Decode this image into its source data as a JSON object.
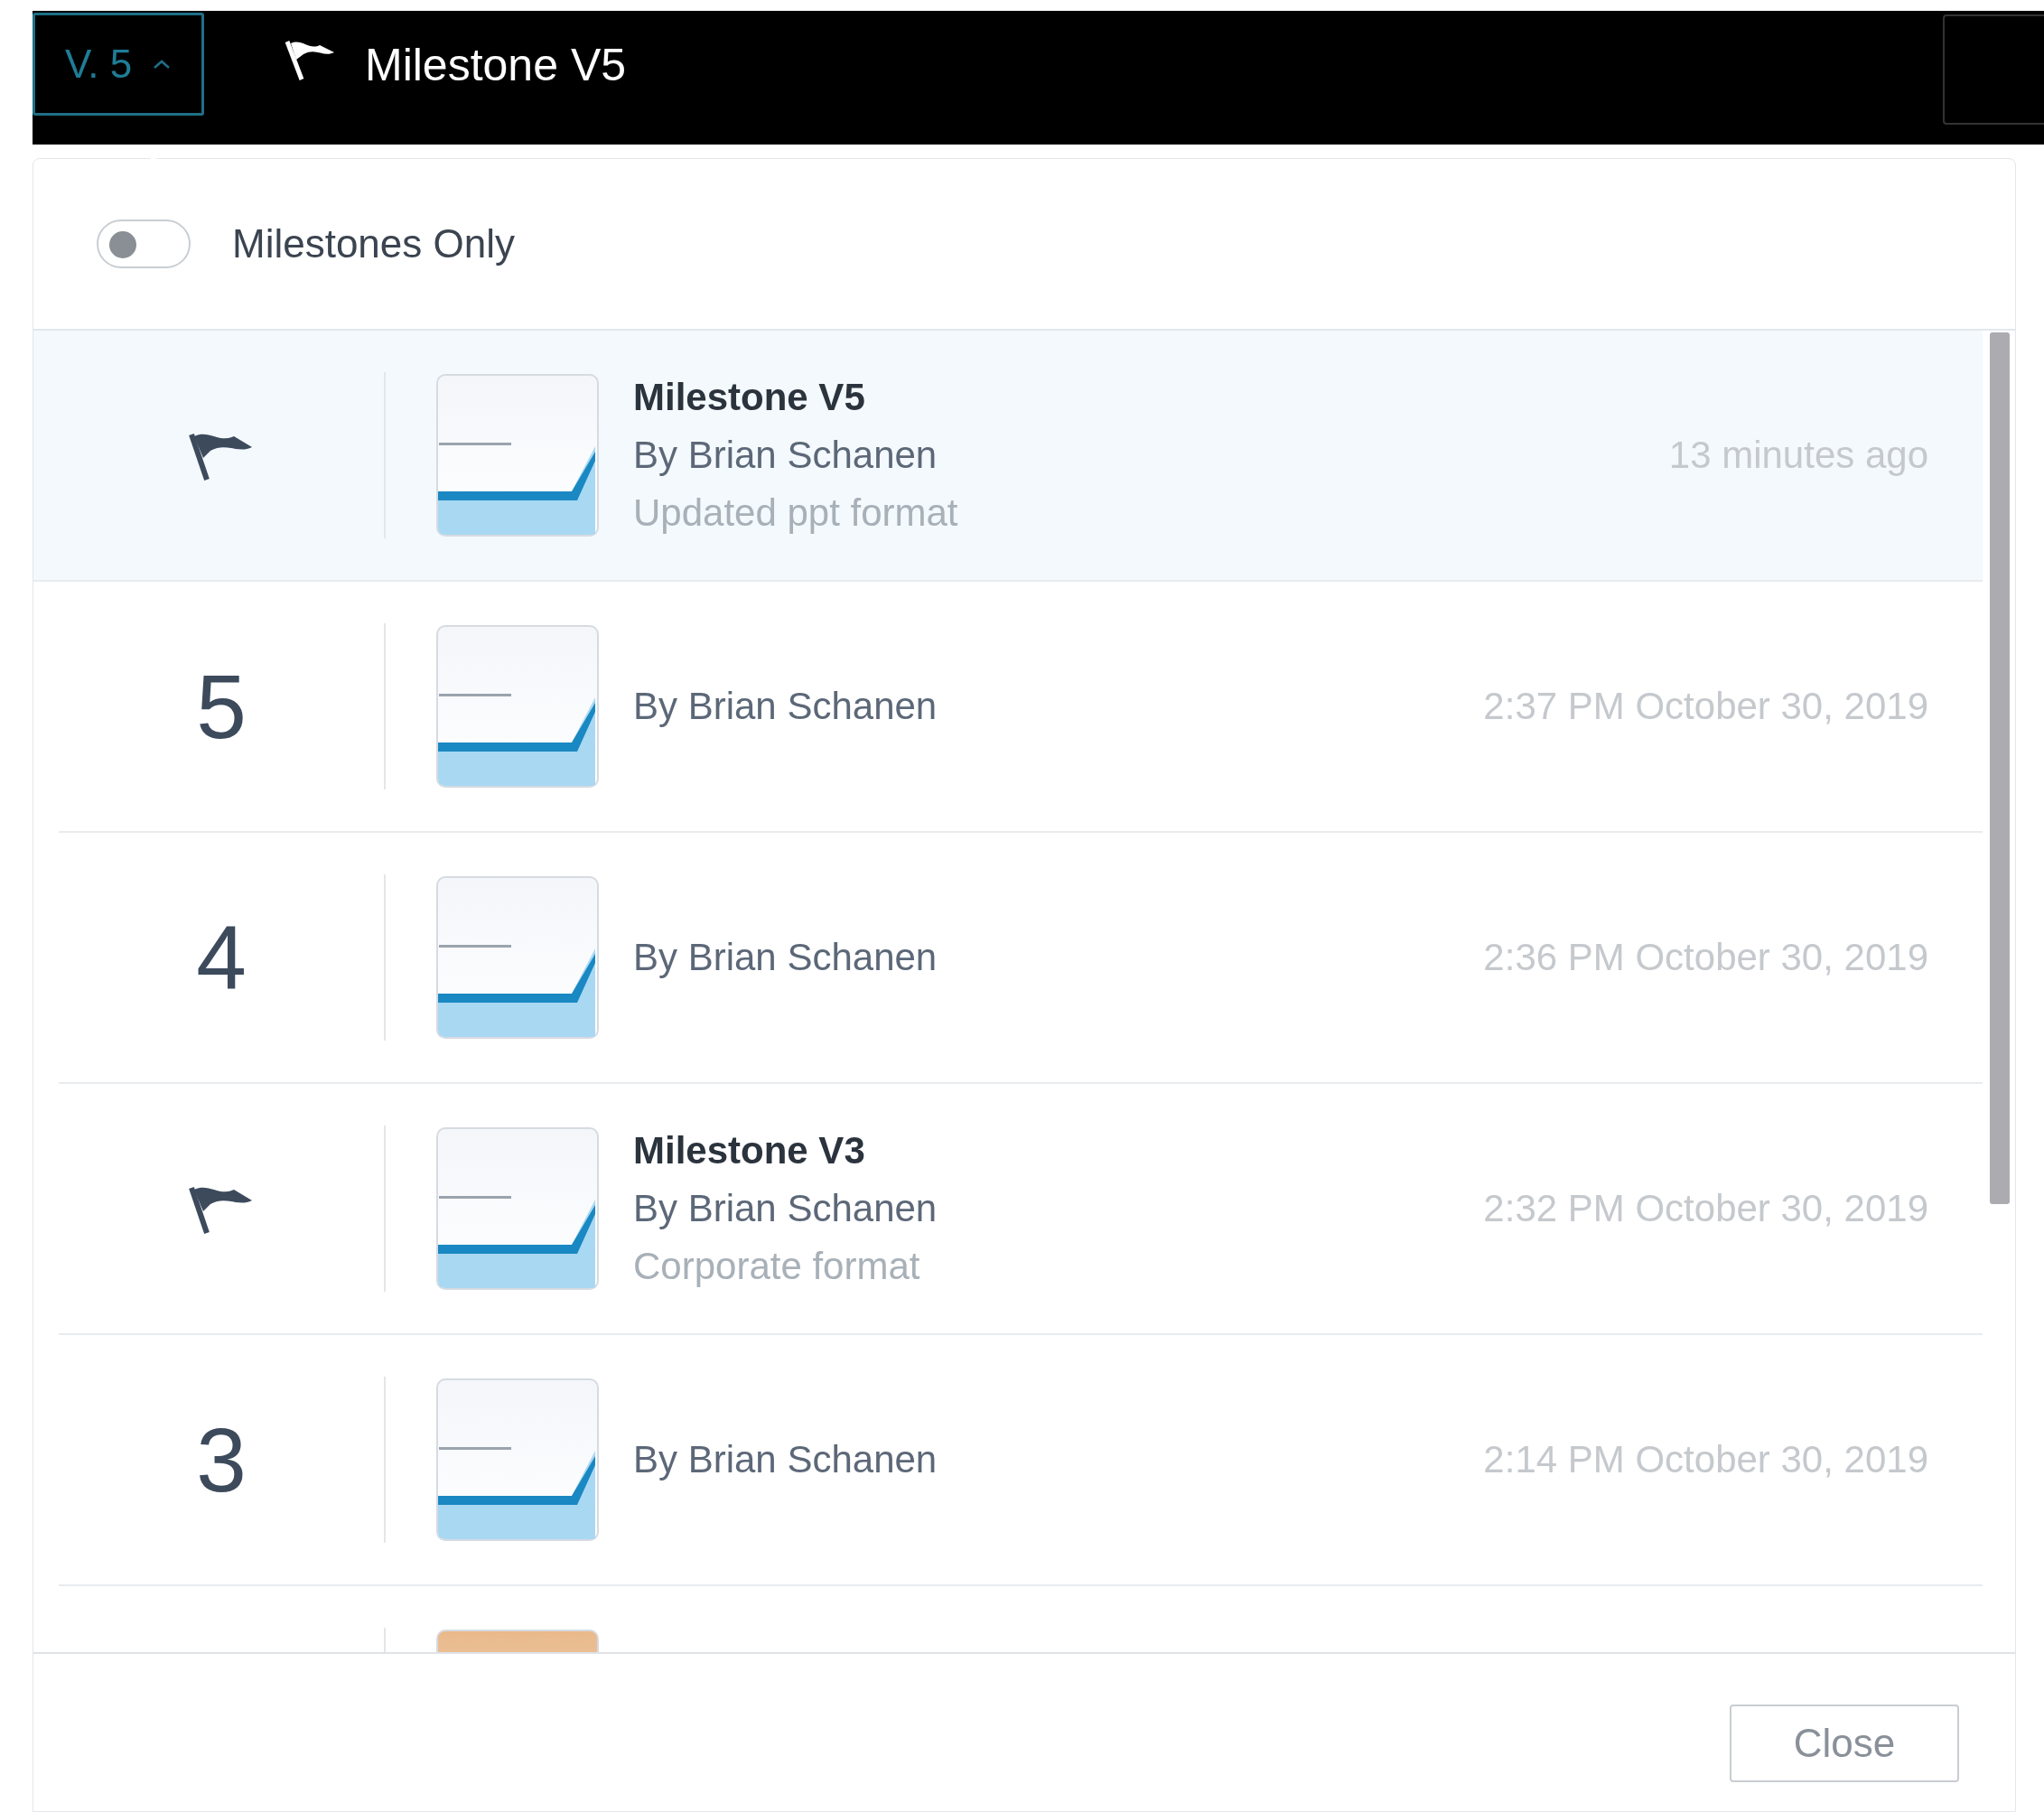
{
  "version_button": {
    "label": "V. 5",
    "expanded": true
  },
  "header": {
    "title": "Milestone V5"
  },
  "milestones_toggle": {
    "label": "Milestones Only",
    "on": false
  },
  "versions": [
    {
      "kind": "milestone",
      "selected": true,
      "title": "Milestone V5",
      "author": "By Brian Schanen",
      "note": "Updated ppt format",
      "time": "13 minutes ago"
    },
    {
      "kind": "version",
      "number": "5",
      "selected": false,
      "author": "By Brian Schanen",
      "time": "2:37 PM October 30, 2019"
    },
    {
      "kind": "version",
      "number": "4",
      "selected": false,
      "author": "By Brian Schanen",
      "time": "2:36 PM October 30, 2019"
    },
    {
      "kind": "milestone",
      "selected": false,
      "title": "Milestone V3",
      "author": "By Brian Schanen",
      "note": "Corporate format",
      "time": "2:32 PM October 30, 2019"
    },
    {
      "kind": "version",
      "number": "3",
      "selected": false,
      "author": "By Brian Schanen",
      "time": "2:14 PM October 30, 2019"
    },
    {
      "kind": "cut",
      "selected": false
    }
  ],
  "close_button": "Close"
}
